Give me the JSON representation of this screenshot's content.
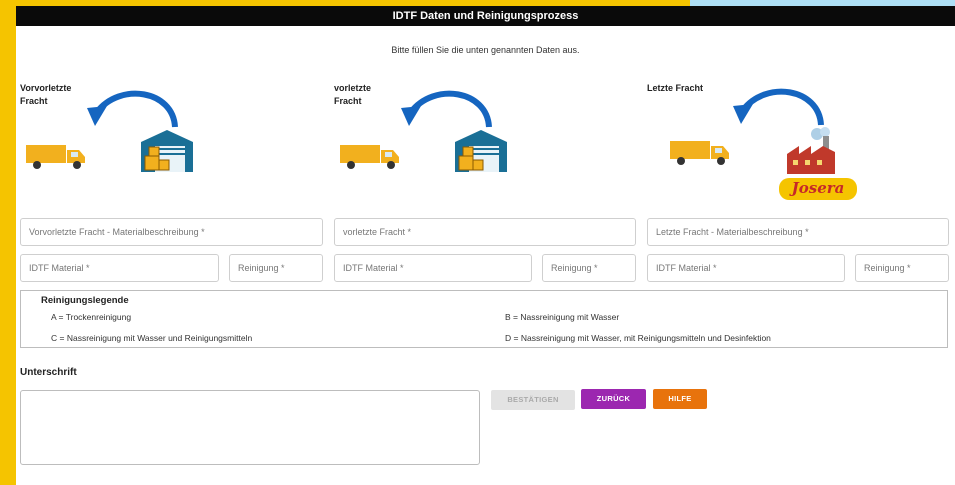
{
  "window": {
    "title": "IDTF Daten und Reinigungsprozess"
  },
  "instruction": "Bitte füllen Sie die unten genannten Daten aus.",
  "columns": [
    {
      "label_line1": "Vorvorletzte",
      "label_line2": "Fracht",
      "material_placeholder": "Vorvorletzte Fracht - Materialbeschreibung *",
      "idtf_placeholder": "IDTF Material *",
      "cleaning_placeholder": "Reinigung *"
    },
    {
      "label_line1": "vorletzte",
      "label_line2": "Fracht",
      "material_placeholder": "vorletzte Fracht *",
      "idtf_placeholder": "IDTF Material *",
      "cleaning_placeholder": "Reinigung *"
    },
    {
      "label_line1": "Letzte Fracht",
      "label_line2": "",
      "material_placeholder": "Letzte Fracht - Materialbeschreibung  *",
      "idtf_placeholder": "IDTF Material *",
      "cleaning_placeholder": "Reinigung *"
    }
  ],
  "brand_logo_text": "Josera",
  "legend": {
    "title": "Reinigungslegende",
    "a": "A = Trockenreinigung",
    "b": "B = Nassreinigung mit Wasser",
    "c": "C = Nassreinigung mit Wasser und Reinigungsmitteln",
    "d": "D = Nassreinigung mit Wasser, mit Reinigungsmitteln und Desinfektion"
  },
  "signature": {
    "label": "Unterschrift"
  },
  "buttons": {
    "confirm": "BESTÄTIGEN",
    "back": "ZURÜCK",
    "help": "HILFE"
  },
  "colors": {
    "accent_yellow": "#f5c400",
    "titlebar": "#0a0a0a",
    "back_button": "#9c27b0",
    "help_button": "#e8730c",
    "arrow_blue": "#1565c0",
    "truck_yellow": "#f2b01e",
    "warehouse_teal": "#1a6f96",
    "factory_red": "#c0392b"
  }
}
